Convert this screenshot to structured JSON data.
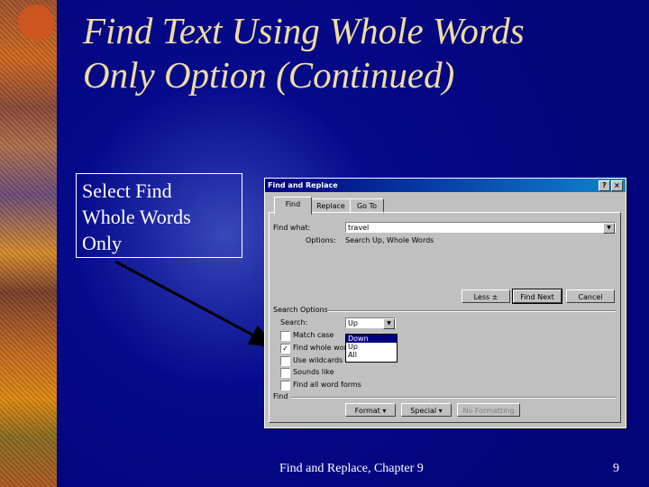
{
  "slide": {
    "title_line1": "Find Text Using Whole Words",
    "title_line2": "Only Option (Continued)",
    "callout_line1": "Select Find",
    "callout_line2": "Whole Words",
    "callout_line3": "Only",
    "footer": "Find and Replace, Chapter 9",
    "page_number": "9"
  },
  "dialog": {
    "title": "Find and Replace",
    "help_label": "?",
    "close_label": "×",
    "tabs": [
      {
        "label": "Find",
        "active": true
      },
      {
        "label": "Replace",
        "active": false
      },
      {
        "label": "Go To",
        "active": false
      }
    ],
    "find_what_label": "Find what:",
    "find_what_value": "travel",
    "options_label": "Options:",
    "options_value": "Search Up, Whole Words",
    "buttons": {
      "less": "Less ±",
      "find_next": "Find Next",
      "cancel": "Cancel",
      "format": "Format ▾",
      "special": "Special ▾",
      "no_formatting": "No Formatting"
    },
    "search_options_label": "Search Options",
    "search_label": "Search:",
    "search_value": "Up",
    "search_dropdown_options": [
      {
        "label": "Down",
        "selected": true
      },
      {
        "label": "Up",
        "selected": false
      },
      {
        "label": "All",
        "selected": false
      }
    ],
    "checkboxes": [
      {
        "label": "Match case",
        "checked": false
      },
      {
        "label": "Find whole words only",
        "checked": true
      },
      {
        "label": "Use wildcards",
        "checked": false
      },
      {
        "label": "Sounds like",
        "checked": false
      },
      {
        "label": "Find all word forms",
        "checked": false
      }
    ],
    "find_group_label": "Find",
    "dropdown_arrow": "▼",
    "checkmark": "✓"
  }
}
